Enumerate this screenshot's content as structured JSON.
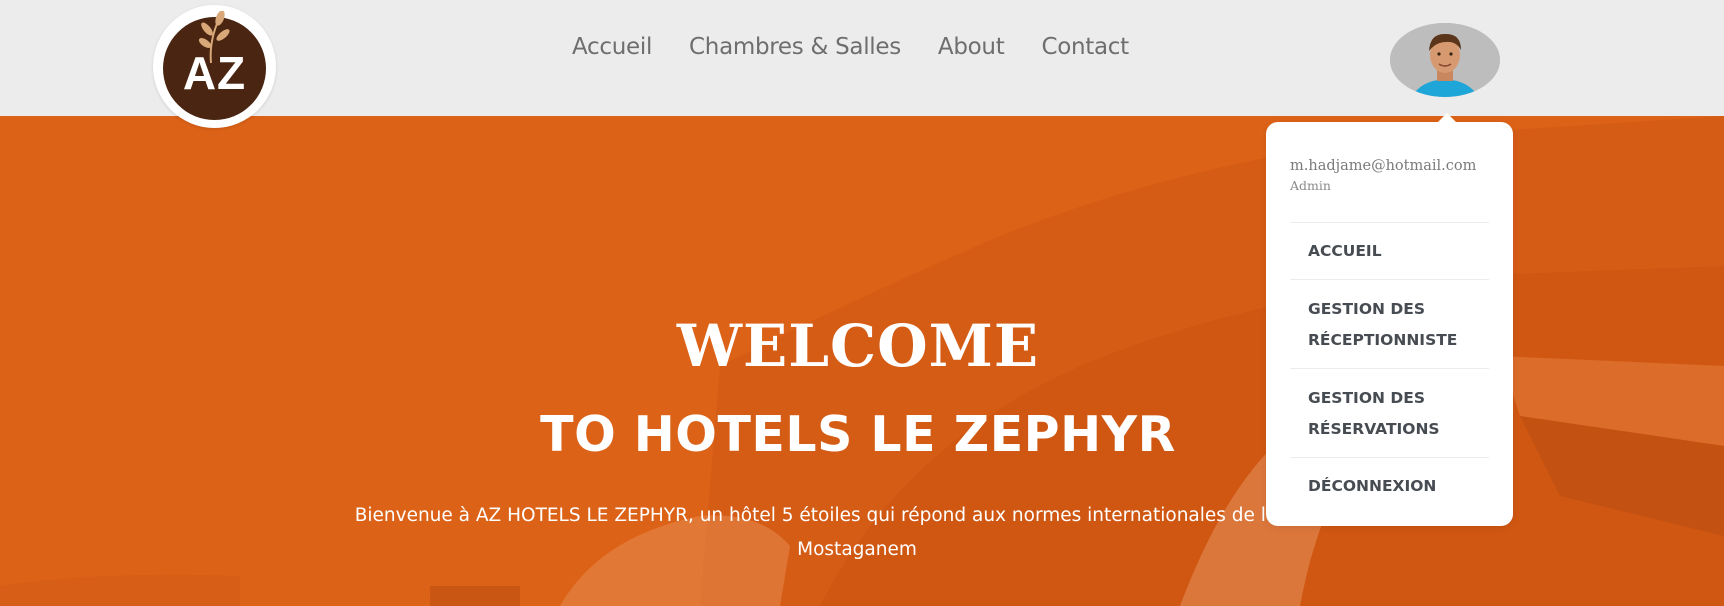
{
  "brand": {
    "logo_text": "AZ"
  },
  "nav": {
    "items": [
      {
        "label": "Accueil"
      },
      {
        "label": "Chambres & Salles"
      },
      {
        "label": "About"
      },
      {
        "label": "Contact"
      }
    ]
  },
  "hero": {
    "welcome": "WELCOME",
    "subtitle": "TO HOTELS LE ZEPHYR",
    "intro_line1": "Bienvenue à AZ HOTELS LE ZEPHYR, un hôtel 5 étoiles qui répond aux normes internationales de l hôtellerie",
    "intro_line2": "Mostaganem"
  },
  "user_menu": {
    "email": "m.hadjame@hotmail.com",
    "role": "Admin",
    "items": [
      {
        "line1": "ACCUEIL"
      },
      {
        "line1": "GESTION DES",
        "line2": "RÉCEPTIONNISTE"
      },
      {
        "line1": "GESTION DES",
        "line2": "RÉSERVATIONS"
      },
      {
        "line1": "DÉCONNEXION"
      }
    ]
  },
  "colors": {
    "header_bg": "#ececec",
    "hero_orange": "#dc6217",
    "logo_brown": "#4a2512",
    "nav_text": "#6e6e6e",
    "menu_text": "#474b52"
  },
  "icons": {
    "logo": "az-hotel-leaf-logo",
    "avatar": "user-avatar-photo"
  }
}
